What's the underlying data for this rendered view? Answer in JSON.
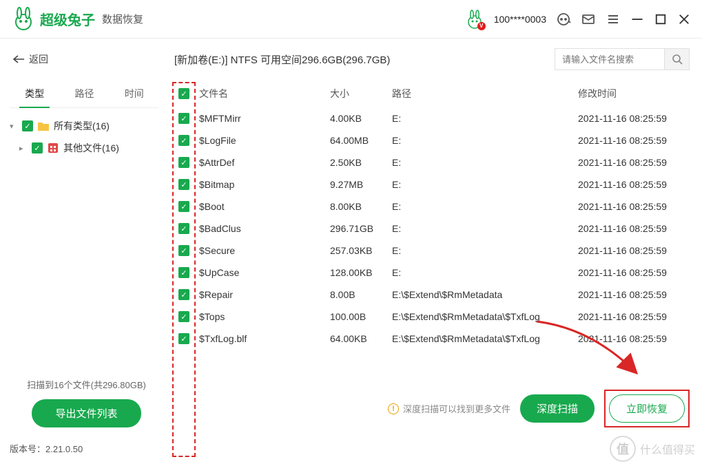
{
  "header": {
    "brand_main": "超级兔子",
    "brand_sub": "数据恢复",
    "phone": "100****0003"
  },
  "nav": {
    "back_label": "返回",
    "drive_info": "[新加卷(E:)] NTFS 可用空间296.6GB(296.7GB)",
    "search_placeholder": "请输入文件名搜索"
  },
  "sidebar": {
    "tabs": {
      "type": "类型",
      "path": "路径",
      "time": "时间"
    },
    "tree": {
      "all_types": "所有类型(16)",
      "other_files": "其他文件(16)"
    }
  },
  "columns": {
    "name": "文件名",
    "size": "大小",
    "path": "路径",
    "mtime": "修改时间"
  },
  "files": [
    {
      "name": "$MFTMirr",
      "size": "4.00KB",
      "path": "E:",
      "mtime": "2021-11-16 08:25:59"
    },
    {
      "name": "$LogFile",
      "size": "64.00MB",
      "path": "E:",
      "mtime": "2021-11-16 08:25:59"
    },
    {
      "name": "$AttrDef",
      "size": "2.50KB",
      "path": "E:",
      "mtime": "2021-11-16 08:25:59"
    },
    {
      "name": "$Bitmap",
      "size": "9.27MB",
      "path": "E:",
      "mtime": "2021-11-16 08:25:59"
    },
    {
      "name": "$Boot",
      "size": "8.00KB",
      "path": "E:",
      "mtime": "2021-11-16 08:25:59"
    },
    {
      "name": "$BadClus",
      "size": "296.71GB",
      "path": "E:",
      "mtime": "2021-11-16 08:25:59"
    },
    {
      "name": "$Secure",
      "size": "257.03KB",
      "path": "E:",
      "mtime": "2021-11-16 08:25:59"
    },
    {
      "name": "$UpCase",
      "size": "128.00KB",
      "path": "E:",
      "mtime": "2021-11-16 08:25:59"
    },
    {
      "name": "$Repair",
      "size": "8.00B",
      "path": "E:\\$Extend\\$RmMetadata",
      "mtime": "2021-11-16 08:25:59"
    },
    {
      "name": "$Tops",
      "size": "100.00B",
      "path": "E:\\$Extend\\$RmMetadata\\$TxfLog",
      "mtime": "2021-11-16 08:25:59"
    },
    {
      "name": "$TxfLog.blf",
      "size": "64.00KB",
      "path": "E:\\$Extend\\$RmMetadata\\$TxfLog",
      "mtime": "2021-11-16 08:25:59"
    }
  ],
  "footer": {
    "scan_summary": "扫描到16个文件(共296.80GB)",
    "export_label": "导出文件列表",
    "hint": "深度扫描可以找到更多文件",
    "deep_scan_label": "深度扫描",
    "recover_label": "立即恢复",
    "version_label": "版本号：2.21.0.50",
    "watermark": "什么值得买",
    "watermark_badge": "值"
  }
}
